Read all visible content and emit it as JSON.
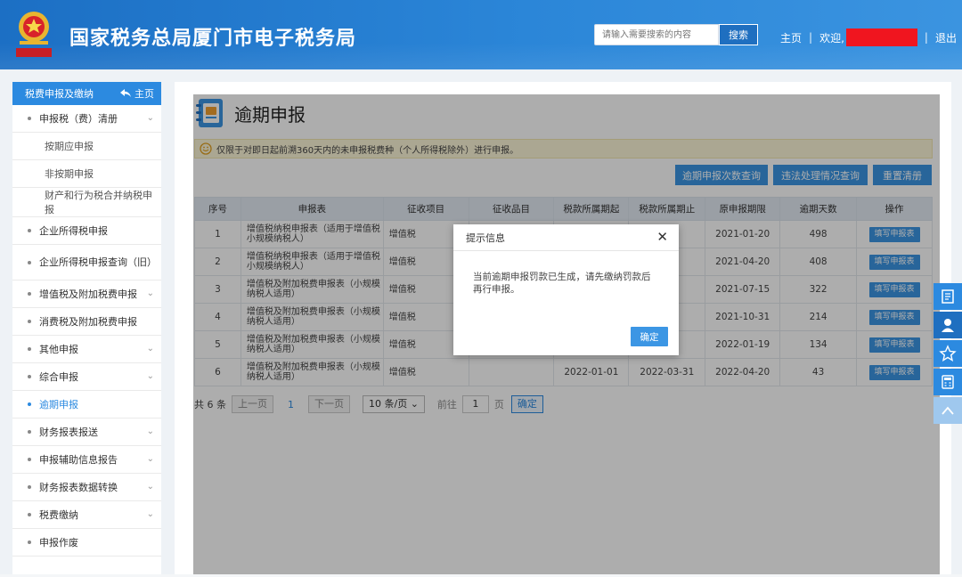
{
  "header": {
    "site_title": "国家税务总局厦门市电子税务局",
    "search_placeholder": "请输入需要搜索的内容",
    "search_button": "搜索",
    "home_link": "主页",
    "welcome": "欢迎,",
    "logout": "退出",
    "colors": {
      "bar": "#2b86d8",
      "redaction": "#f0151f"
    }
  },
  "sidebar": {
    "header_label": "税费申报及缴纳",
    "home_label": "主页",
    "items": [
      {
        "label": "申报税（费）清册",
        "expandable": true
      },
      {
        "label": "按期应申报",
        "sub": true
      },
      {
        "label": "非按期申报",
        "sub": true
      },
      {
        "label": "财产和行为税合并纳税申报",
        "sub": true
      },
      {
        "label": "企业所得税申报"
      },
      {
        "label": "企业所得税申报查询（旧）"
      },
      {
        "label": "增值税及附加税费申报",
        "expandable": true
      },
      {
        "label": "消费税及附加税费申报"
      },
      {
        "label": "其他申报",
        "expandable": true
      },
      {
        "label": "综合申报",
        "expandable": true
      },
      {
        "label": "逾期申报",
        "active": true
      },
      {
        "label": "财务报表报送",
        "expandable": true
      },
      {
        "label": "申报辅助信息报告",
        "expandable": true
      },
      {
        "label": "财务报表数据转换",
        "expandable": true
      },
      {
        "label": "税费缴纳",
        "expandable": true
      },
      {
        "label": "申报作废"
      }
    ]
  },
  "page": {
    "title": "逾期申报",
    "notice": "仅限于对即日起前溯360天内的未申报税费种（个人所得税除外）进行申报。",
    "buttons": [
      "逾期申报次数查询",
      "违法处理情况查询",
      "重置清册"
    ]
  },
  "table": {
    "headers": [
      "序号",
      "申报表",
      "征收项目",
      "征收品目",
      "税款所属期起",
      "税款所属期止",
      "原申报期限",
      "逾期天数",
      "操作"
    ],
    "rows": [
      [
        "1",
        "增值税纳税申报表（适用于增值税小规模纳税人）",
        "增值税",
        "",
        "",
        "-31",
        "2021-01-20",
        "498",
        "填写申报表"
      ],
      [
        "2",
        "增值税纳税申报表（适用于增值税小规模纳税人）",
        "增值税",
        "",
        "",
        "-31",
        "2021-04-20",
        "408",
        "填写申报表"
      ],
      [
        "3",
        "增值税及附加税费申报表（小规模纳税人适用）",
        "增值税",
        "",
        "",
        "-30",
        "2021-07-15",
        "322",
        "填写申报表"
      ],
      [
        "4",
        "增值税及附加税费申报表（小规模纳税人适用）",
        "增值税",
        "",
        "",
        "-30",
        "2021-10-31",
        "214",
        "填写申报表"
      ],
      [
        "5",
        "增值税及附加税费申报表（小规模纳税人适用）",
        "增值税",
        "",
        "",
        "-31",
        "2022-01-19",
        "134",
        "填写申报表"
      ],
      [
        "6",
        "增值税及附加税费申报表（小规模纳税人适用）",
        "增值税",
        "",
        "2022-01-01",
        "2022-03-31",
        "2022-04-20",
        "43",
        "填写申报表"
      ]
    ]
  },
  "pager": {
    "total": "共 6 条",
    "prev": "上一页",
    "current": "1",
    "next": "下一页",
    "page_size": "10 条/页",
    "goto_prefix": "前往",
    "goto_value": "1",
    "goto_suffix": "页",
    "confirm": "确定"
  },
  "modal": {
    "title": "提示信息",
    "message": "当前逾期申报罚款已生成，请先缴纳罚款后再行申报。",
    "ok": "确定"
  },
  "floatbar": {
    "icons": [
      "form-icon",
      "customer-service-icon",
      "star-icon",
      "calculator-icon",
      "up-arrow-icon"
    ]
  }
}
